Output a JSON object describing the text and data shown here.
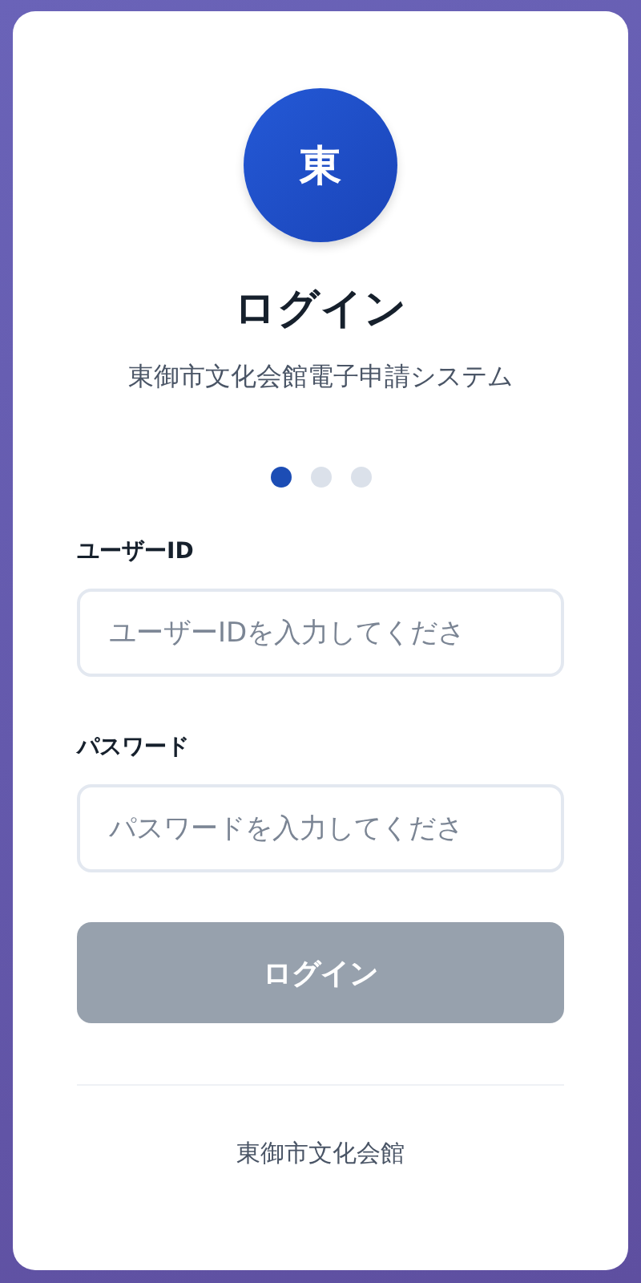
{
  "logo": {
    "text": "東"
  },
  "title": "ログイン",
  "subtitle": "東御市文化会館電子申請システム",
  "steps": [
    {
      "selected": true
    },
    {
      "selected": false
    },
    {
      "selected": false
    }
  ],
  "fields": [
    {
      "label": "ユーザーID",
      "placeholder": "ユーザーIDを入力してくださ"
    },
    {
      "label": "パスワード",
      "placeholder": "パスワードを入力してくださ"
    }
  ],
  "submit": {
    "label": "ログイン",
    "disabled": true
  },
  "footer": "東御市文化会館"
}
